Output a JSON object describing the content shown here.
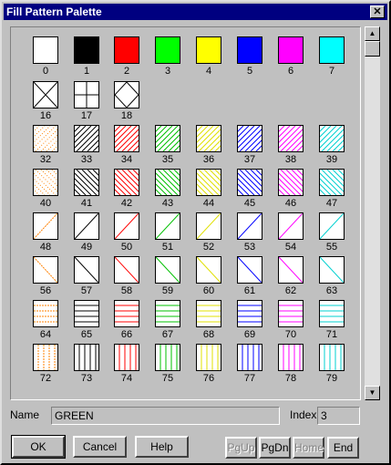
{
  "window": {
    "title": "Fill Pattern Palette",
    "close_label": "✕"
  },
  "colors": {
    "black": "#000000",
    "red": "#ff0000",
    "green": "#00ff00",
    "yellow": "#ffff00",
    "blue": "#0000ff",
    "magenta": "#ff00ff",
    "cyan": "#00ffff",
    "white": "#ffffff"
  },
  "swatches": [
    {
      "num": "0",
      "color": "#ffffff",
      "pattern": "solid"
    },
    {
      "num": "1",
      "color": "#000000",
      "pattern": "solid"
    },
    {
      "num": "2",
      "color": "#ff0000",
      "pattern": "solid"
    },
    {
      "num": "3",
      "color": "#00ff00",
      "pattern": "solid"
    },
    {
      "num": "4",
      "color": "#ffff00",
      "pattern": "solid"
    },
    {
      "num": "5",
      "color": "#0000ff",
      "pattern": "solid"
    },
    {
      "num": "6",
      "color": "#ff00ff",
      "pattern": "solid"
    },
    {
      "num": "7",
      "color": "#00ffff",
      "pattern": "solid"
    },
    {
      "num": "16",
      "color": "#000000",
      "pattern": "x"
    },
    {
      "num": "17",
      "color": "#000000",
      "pattern": "plus"
    },
    {
      "num": "18",
      "color": "#000000",
      "pattern": "diamond"
    },
    {
      "num": "32",
      "color": "#ff8000",
      "pattern": "dots"
    },
    {
      "num": "33",
      "color": "#000000",
      "pattern": "diag-dense"
    },
    {
      "num": "34",
      "color": "#ff0000",
      "pattern": "diag-dense"
    },
    {
      "num": "35",
      "color": "#00c000",
      "pattern": "diag-dense"
    },
    {
      "num": "36",
      "color": "#e0e000",
      "pattern": "diag-dense"
    },
    {
      "num": "37",
      "color": "#0000ff",
      "pattern": "diag-dense"
    },
    {
      "num": "38",
      "color": "#ff00ff",
      "pattern": "diag-dense"
    },
    {
      "num": "39",
      "color": "#00d0d0",
      "pattern": "diag-dense"
    },
    {
      "num": "40",
      "color": "#ff8000",
      "pattern": "dots-back"
    },
    {
      "num": "41",
      "color": "#000000",
      "pattern": "back-dense"
    },
    {
      "num": "42",
      "color": "#ff0000",
      "pattern": "back-dense"
    },
    {
      "num": "43",
      "color": "#00c000",
      "pattern": "back-dense"
    },
    {
      "num": "44",
      "color": "#e0e000",
      "pattern": "back-dense"
    },
    {
      "num": "45",
      "color": "#0000ff",
      "pattern": "back-dense"
    },
    {
      "num": "46",
      "color": "#ff00ff",
      "pattern": "back-dense"
    },
    {
      "num": "47",
      "color": "#00d0d0",
      "pattern": "back-dense"
    },
    {
      "num": "48",
      "color": "#ff8000",
      "pattern": "diag-sparse"
    },
    {
      "num": "49",
      "color": "#000000",
      "pattern": "diag-sparse"
    },
    {
      "num": "50",
      "color": "#ff0000",
      "pattern": "diag-sparse"
    },
    {
      "num": "51",
      "color": "#00c000",
      "pattern": "diag-sparse"
    },
    {
      "num": "52",
      "color": "#e0e000",
      "pattern": "diag-sparse"
    },
    {
      "num": "53",
      "color": "#0000ff",
      "pattern": "diag-sparse"
    },
    {
      "num": "54",
      "color": "#ff00ff",
      "pattern": "diag-sparse"
    },
    {
      "num": "55",
      "color": "#00d0d0",
      "pattern": "diag-sparse"
    },
    {
      "num": "56",
      "color": "#ff8000",
      "pattern": "back-sparse"
    },
    {
      "num": "57",
      "color": "#000000",
      "pattern": "back-sparse"
    },
    {
      "num": "58",
      "color": "#ff0000",
      "pattern": "back-sparse"
    },
    {
      "num": "59",
      "color": "#00c000",
      "pattern": "back-sparse"
    },
    {
      "num": "60",
      "color": "#e0e000",
      "pattern": "back-sparse"
    },
    {
      "num": "61",
      "color": "#0000ff",
      "pattern": "back-sparse"
    },
    {
      "num": "62",
      "color": "#ff00ff",
      "pattern": "back-sparse"
    },
    {
      "num": "63",
      "color": "#00d0d0",
      "pattern": "back-sparse"
    },
    {
      "num": "64",
      "color": "#ff8000",
      "pattern": "horiz"
    },
    {
      "num": "65",
      "color": "#000000",
      "pattern": "horiz"
    },
    {
      "num": "66",
      "color": "#ff0000",
      "pattern": "horiz"
    },
    {
      "num": "67",
      "color": "#00c000",
      "pattern": "horiz"
    },
    {
      "num": "68",
      "color": "#e0e000",
      "pattern": "horiz"
    },
    {
      "num": "69",
      "color": "#0000ff",
      "pattern": "horiz"
    },
    {
      "num": "70",
      "color": "#ff00ff",
      "pattern": "horiz"
    },
    {
      "num": "71",
      "color": "#00d0d0",
      "pattern": "horiz"
    },
    {
      "num": "72",
      "color": "#ff8000",
      "pattern": "vert"
    },
    {
      "num": "73",
      "color": "#000000",
      "pattern": "vert"
    },
    {
      "num": "74",
      "color": "#ff0000",
      "pattern": "vert"
    },
    {
      "num": "75",
      "color": "#00c000",
      "pattern": "vert"
    },
    {
      "num": "76",
      "color": "#e0e000",
      "pattern": "vert"
    },
    {
      "num": "77",
      "color": "#0000ff",
      "pattern": "vert"
    },
    {
      "num": "78",
      "color": "#ff00ff",
      "pattern": "vert"
    },
    {
      "num": "79",
      "color": "#00d0d0",
      "pattern": "vert"
    }
  ],
  "scrollbar": {
    "up_icon": "▲",
    "down_icon": "▼"
  },
  "name_field": {
    "label": "Name",
    "value": "GREEN"
  },
  "index_field": {
    "label": "Index",
    "value": "3"
  },
  "buttons": {
    "ok": "OK",
    "cancel": "Cancel",
    "help": "Help",
    "pgup": "PgUp",
    "pgdn": "PgDn",
    "home": "Home",
    "end": "End"
  }
}
